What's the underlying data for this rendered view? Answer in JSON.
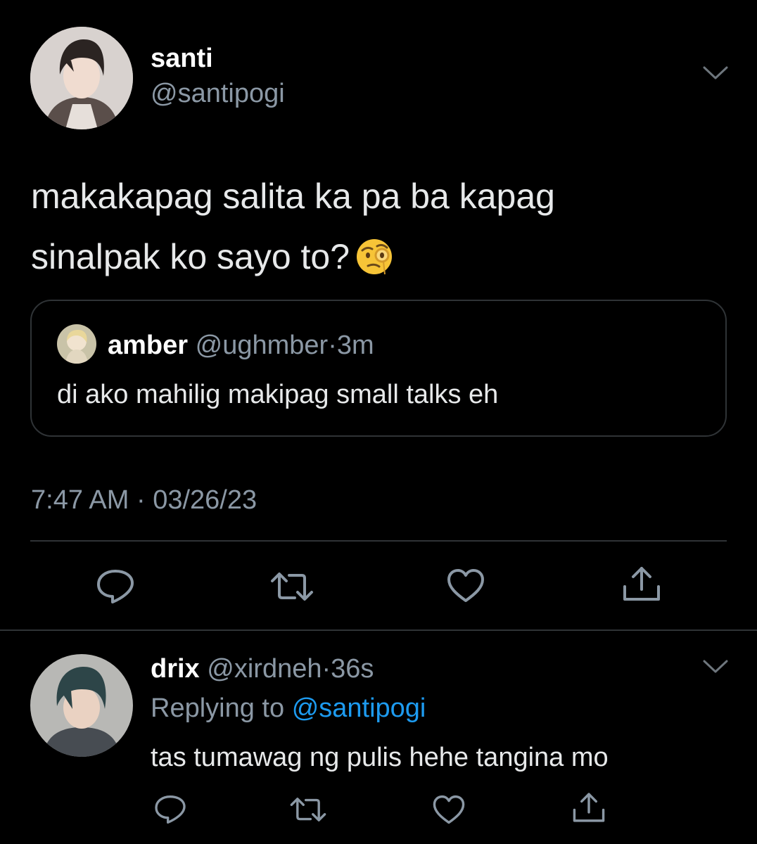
{
  "tweet": {
    "author_name": "santi",
    "author_handle": "@santipogi",
    "text_line1": "makakapag salita ka pa ba kapag",
    "text_line2": "sinalpak ko sayo to?",
    "emoji": "face-with-monocle",
    "timestamp_time": "7:47 AM",
    "timestamp_sep": "·",
    "timestamp_date": "03/26/23",
    "quote": {
      "author_name": "amber",
      "author_handle": "@ughmber",
      "sep": "·",
      "time": "3m",
      "text": "di ako mahilig makipag small talks eh"
    }
  },
  "reply": {
    "author_name": "drix",
    "author_handle": "@xirdneh",
    "sep": "·",
    "time": "36s",
    "replying_prefix": "Replying to",
    "replying_handle": "@santipogi",
    "text": "tas tumawag ng pulis hehe tangina mo"
  },
  "icons": {
    "reply": "reply-icon",
    "retweet": "retweet-icon",
    "like": "heart-icon",
    "share": "share-icon",
    "more": "chevron-down-icon"
  },
  "colors": {
    "background": "#000000",
    "text": "#e7e9ea",
    "secondary": "#8b98a5",
    "link": "#1d9bf0",
    "border": "#2f3336"
  }
}
